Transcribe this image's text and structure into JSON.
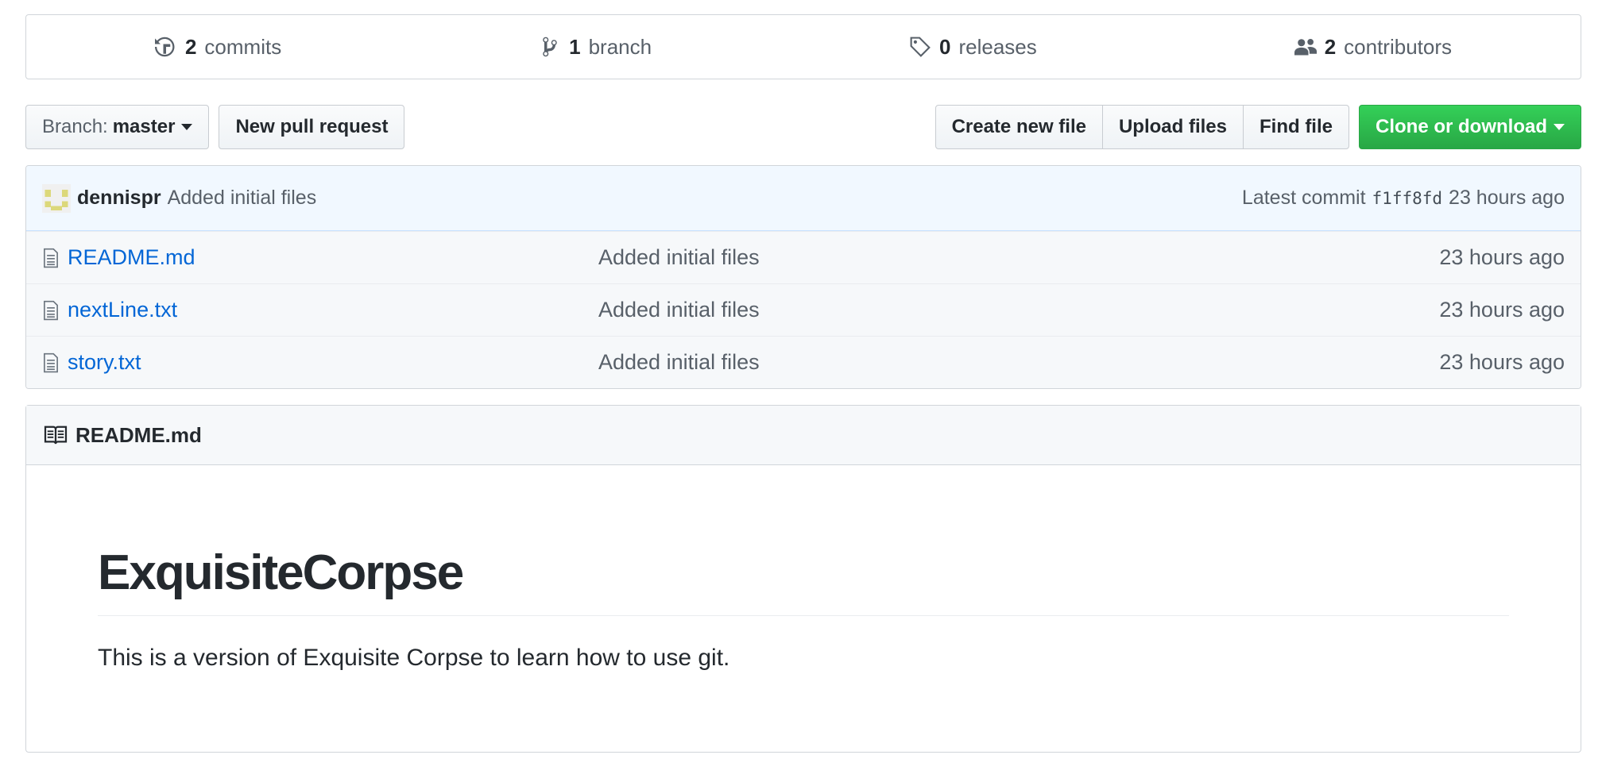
{
  "summary": {
    "commits": {
      "count": "2",
      "label": "commits"
    },
    "branches": {
      "count": "1",
      "label": "branch"
    },
    "releases": {
      "count": "0",
      "label": "releases"
    },
    "contributors": {
      "count": "2",
      "label": "contributors"
    }
  },
  "toolbar": {
    "branch_prefix": "Branch:",
    "branch_name": "master",
    "new_pull_request": "New pull request",
    "create_new_file": "Create new file",
    "upload_files": "Upload files",
    "find_file": "Find file",
    "clone_or_download": "Clone or download"
  },
  "latest_commit": {
    "author": "dennispr",
    "message": "Added initial files",
    "prefix": "Latest commit",
    "sha": "f1ff8fd",
    "age": "23 hours ago"
  },
  "files": [
    {
      "name": "README.md",
      "message": "Added initial files",
      "age": "23 hours ago"
    },
    {
      "name": "nextLine.txt",
      "message": "Added initial files",
      "age": "23 hours ago"
    },
    {
      "name": "story.txt",
      "message": "Added initial files",
      "age": "23 hours ago"
    }
  ],
  "readme": {
    "filename": "README.md",
    "heading": "ExquisiteCorpse",
    "paragraph": "This is a version of Exquisite Corpse to learn how to use git."
  },
  "colors": {
    "link": "#0366d6",
    "green_button": "#28a745",
    "commit_bar_bg": "#f1f8ff"
  }
}
